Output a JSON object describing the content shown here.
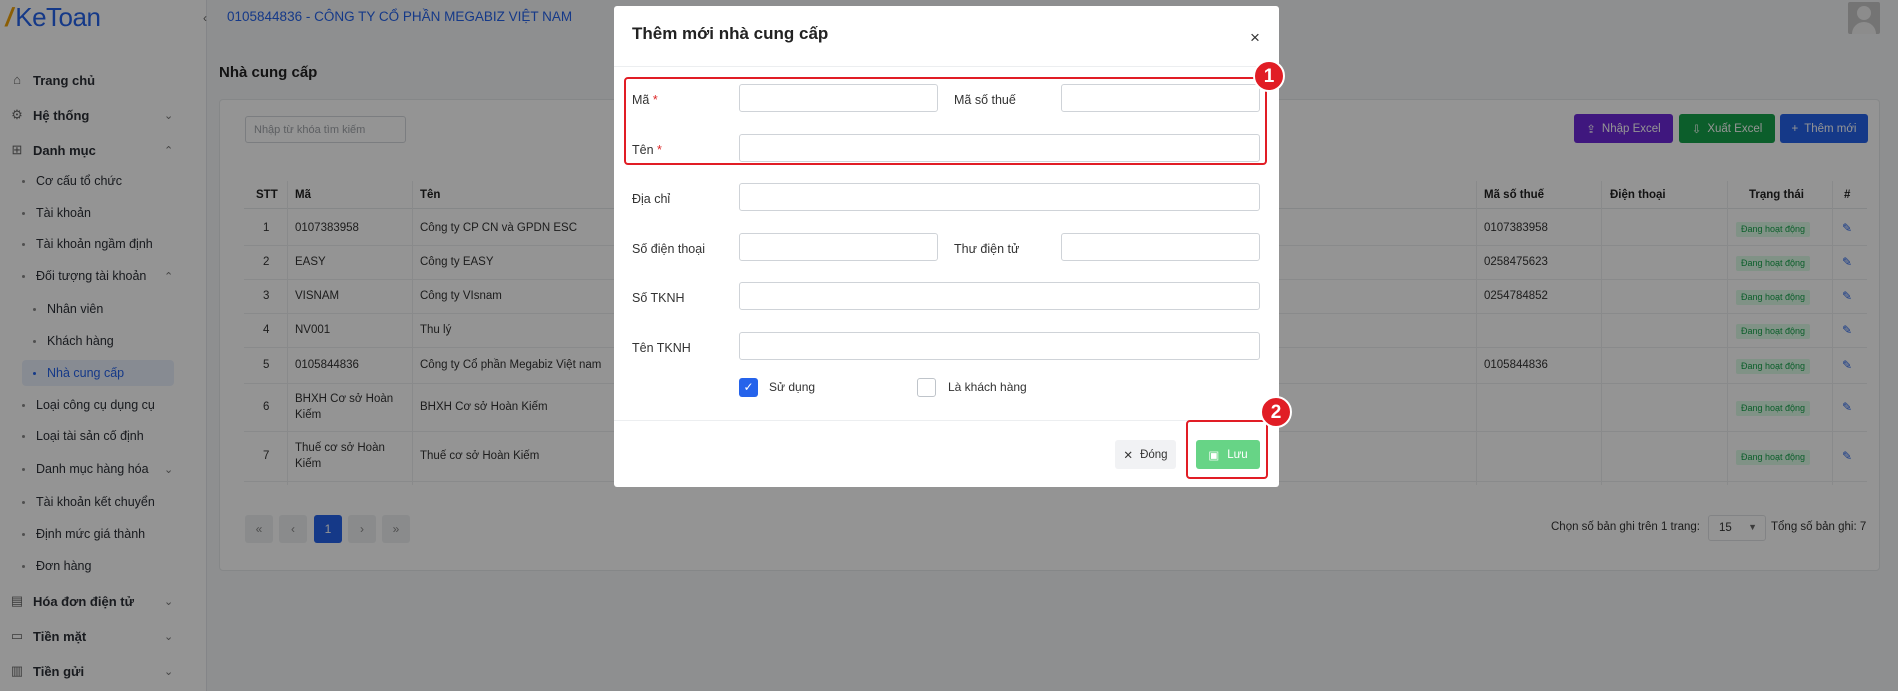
{
  "app": {
    "logo_mark": "/",
    "logo_text": "KeToan",
    "company": "0105844836 - CÔNG TY CỔ PHẦN MEGABIZ VIỆT NAM",
    "collapse_icon": "chevron-left-icon"
  },
  "sidebar": {
    "top_items": [
      {
        "label": "Trang chủ",
        "icon": "home-icon"
      },
      {
        "label": "Hệ thống",
        "icon": "gear-icon"
      },
      {
        "label": "Danh mục",
        "icon": "grid-icon"
      }
    ],
    "danh_muc_items": [
      "Cơ cấu tổ chức",
      "Tài khoản",
      "Tài khoản ngầm định",
      "Đối tượng tài khoản"
    ],
    "doi_tuong_items": [
      "Nhân viên",
      "Khách hàng",
      "Nhà cung cấp"
    ],
    "more_items": [
      "Loại công cụ dụng cụ",
      "Loại tài sản cố định",
      "Danh mục hàng hóa",
      "Tài khoản kết chuyển",
      "Định mức giá thành",
      "Đơn hàng"
    ],
    "bottom_items": [
      {
        "label": "Hóa đơn điện tử",
        "icon": "invoice-icon"
      },
      {
        "label": "Tiền mặt",
        "icon": "cash-icon"
      },
      {
        "label": "Tiền gửi",
        "icon": "bank-icon"
      }
    ]
  },
  "page": {
    "title": "Nhà cung cấp",
    "search_placeholder": "Nhập từ khóa tìm kiếm",
    "buttons": {
      "import": "Nhập Excel",
      "export": "Xuất Excel",
      "add": "Thêm mới"
    }
  },
  "table": {
    "headers": {
      "stt": "STT",
      "ma": "Mã",
      "ten": "Tên",
      "mst": "Mã số thuế",
      "dt": "Điện thoại",
      "status": "Trạng thái",
      "action": "#"
    },
    "rows": [
      {
        "stt": "1",
        "ma": "0107383958",
        "ten": "Công ty CP CN và GPDN ESC",
        "mst": "0107383958",
        "status": "Đang hoạt động"
      },
      {
        "stt": "2",
        "ma": "EASY",
        "ten": "Công ty EASY",
        "mst": "0258475623",
        "status": "Đang hoạt động"
      },
      {
        "stt": "3",
        "ma": "VISNAM",
        "ten": "Công ty VIsnam",
        "mst": "0254784852",
        "status": "Đang hoạt động"
      },
      {
        "stt": "4",
        "ma": "NV001",
        "ten": "Thu lý",
        "mst": "",
        "status": "Đang hoạt động"
      },
      {
        "stt": "5",
        "ma": "0105844836",
        "ten": "Công ty Cổ phần Megabiz Việt nam",
        "mst": "0105844836",
        "status": "Đang hoạt động"
      },
      {
        "stt": "6",
        "ma": "BHXH Cơ sở Hoàn Kiếm",
        "ma_line1": "BHXH Cơ sở Hoàn",
        "ma_line2": "Kiếm",
        "ten": "BHXH Cơ sở Hoàn Kiếm",
        "mst": "",
        "status": "Đang hoạt động"
      },
      {
        "stt": "7",
        "ma": "Thuế cơ sở Hoàn Kiếm",
        "ma_line1": "Thuế cơ sở Hoàn",
        "ma_line2": "Kiếm",
        "ten": "Thuế cơ sở Hoàn Kiếm",
        "mst": "",
        "status": "Đang hoạt động"
      }
    ]
  },
  "pagination": {
    "current": "1",
    "per_page_label": "Chọn số bản ghi trên 1 trang:",
    "per_page": "15",
    "total_label": "Tổng số bản ghi:",
    "total": "7"
  },
  "modal": {
    "title": "Thêm mới nhà cung cấp",
    "close_glyph": "×",
    "fields": {
      "ma": "Mã",
      "mst": "Mã số thuế",
      "ten": "Tên",
      "dia_chi": "Địa chỉ",
      "sdt": "Số điện thoại",
      "email": "Thư điện tử",
      "so_tknh": "Số TKNH",
      "ten_tknh": "Tên TKNH",
      "required_mark": "*"
    },
    "checkboxes": {
      "su_dung": "Sử dụng",
      "su_dung_checked": true,
      "la_khach_hang": "Là khách hàng",
      "la_khach_hang_checked": false
    },
    "buttons": {
      "close": "Đóng",
      "save": "Lưu"
    }
  },
  "annotations": {
    "marker1": "1",
    "marker2": "2",
    "highlight_color": "#e11d25"
  },
  "colors": {
    "primary": "#2563eb",
    "success": "#16a34a",
    "purple": "#6d28d9",
    "save_disabled": "#67d486"
  }
}
